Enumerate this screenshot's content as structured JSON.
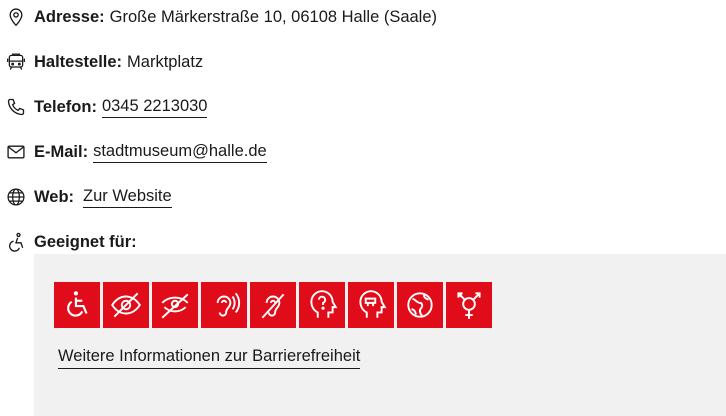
{
  "address": {
    "label": "Adresse:",
    "value": "Große Märkerstraße 10, 06108 Halle (Saale)",
    "icon": "map-pin-icon"
  },
  "stop": {
    "label": "Haltestelle:",
    "value": "Marktplatz",
    "icon": "tram-icon"
  },
  "phone": {
    "label": "Telefon:",
    "value": "0345 2213030",
    "icon": "phone-icon"
  },
  "email": {
    "label": "E-Mail:",
    "value": "stadtmuseum@halle.de",
    "icon": "envelope-icon"
  },
  "web": {
    "label": "Web:",
    "value": "Zur Website",
    "icon": "globe-icon"
  },
  "suitable": {
    "label": "Geeignet für:",
    "icon": "accessibility-icon",
    "tiles": [
      "wheelchair-icon",
      "visually-impaired-icon",
      "blind-icon",
      "hard-of-hearing-icon",
      "deaf-icon",
      "cognitive-impairment-icon",
      "learning-difficulty-icon",
      "world-language-icon",
      "all-genders-icon"
    ],
    "more_link": "Weitere Informationen zur Barrierefreiheit"
  },
  "colors": {
    "tile": "#e10c1a",
    "panel": "#f1f1f1",
    "text": "#1a1a1a"
  }
}
